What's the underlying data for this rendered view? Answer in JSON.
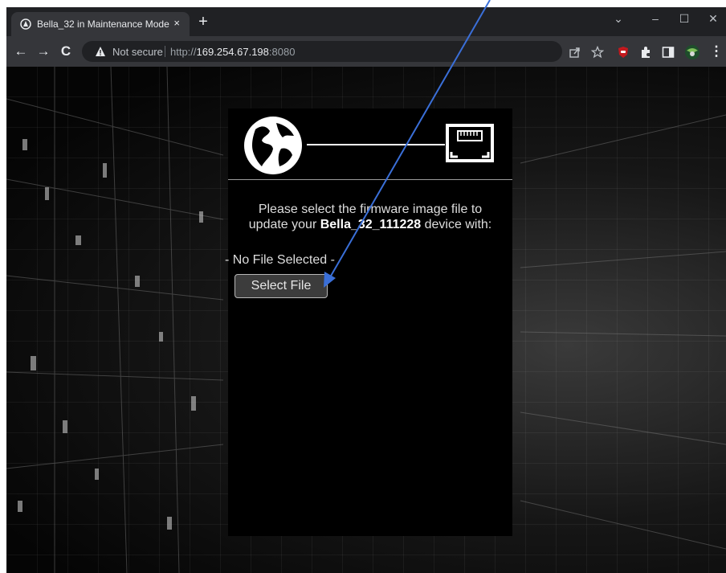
{
  "browser": {
    "tab": {
      "title": "Bella_32 in Maintenance Mode",
      "close": "×"
    },
    "new_tab": "+",
    "window_controls": {
      "tab_search": "⌄",
      "minimize": "–",
      "maximize": "☐",
      "close": "✕"
    },
    "nav": {
      "back": "←",
      "forward": "→",
      "reload": "C"
    },
    "omnibox": {
      "security_label": "Not secure",
      "url_scheme": "http://",
      "url_host": "169.254.67.198",
      "url_port": ":8080"
    },
    "icons": [
      "share-icon",
      "star-icon",
      "ublock-icon",
      "extensions-icon",
      "side-panel-icon",
      "profile-avatar-icon",
      "menu-icon"
    ]
  },
  "page": {
    "instruction_line1": "Please select the firmware image file to",
    "instruction_line2_prefix": "update your ",
    "device_name": "Bella_32_111228",
    "instruction_line2_suffix": " device with:",
    "file_status": "- No File Selected -",
    "select_button": "Select File"
  },
  "colors": {
    "panel_bg": "#000000",
    "annotation_arrow": "#3a6fd8"
  }
}
